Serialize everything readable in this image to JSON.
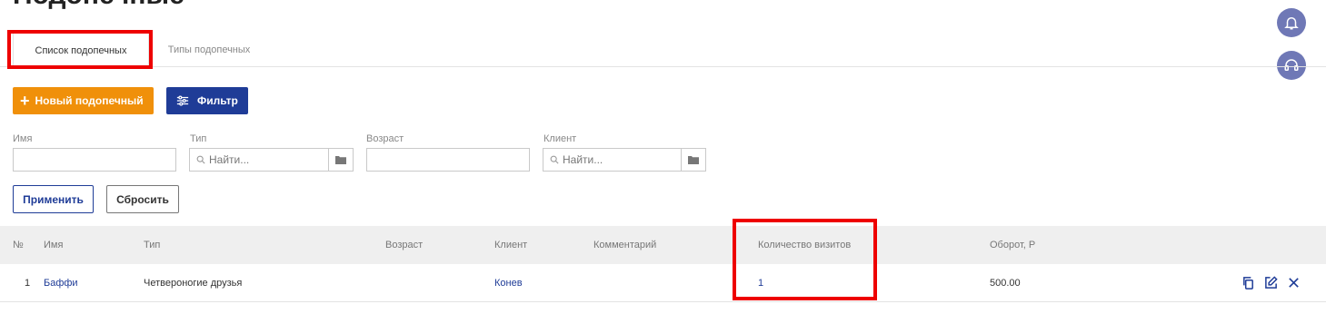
{
  "page": {
    "title": "Подопечные"
  },
  "tabs": [
    {
      "label": "Список подопечных",
      "active": true
    },
    {
      "label": "Типы подопечных",
      "active": false
    }
  ],
  "toolbar": {
    "new_label": "Новый подопечный",
    "filter_label": "Фильтр"
  },
  "filters": {
    "name_label": "Имя",
    "type_label": "Тип",
    "type_placeholder": "Найти...",
    "age_label": "Возраст",
    "client_label": "Клиент",
    "client_placeholder": "Найти...",
    "apply_label": "Применить",
    "reset_label": "Сбросить"
  },
  "table": {
    "headers": {
      "num": "№",
      "name": "Имя",
      "type": "Тип",
      "age": "Возраст",
      "client": "Клиент",
      "comment": "Комментарий",
      "visits": "Количество визитов",
      "turnover": "Оборот, Р"
    },
    "rows": [
      {
        "num": "1",
        "name": "Баффи",
        "type": "Четвероногие друзья",
        "age": "",
        "client": "Конев",
        "comment": "",
        "visits": "1",
        "turnover": "500.00"
      }
    ]
  },
  "icons": {
    "notifications": "bell-icon",
    "support": "headset-icon",
    "copy": "copy-icon",
    "edit": "edit-icon",
    "delete": "close-icon",
    "search": "search-icon",
    "folder": "folder-icon",
    "filter": "sliders-icon"
  },
  "colors": {
    "accent_orange": "#f0900a",
    "primary_blue": "#1f3c97",
    "side_button": "#6f78b6",
    "highlight_red": "#ee0000"
  }
}
